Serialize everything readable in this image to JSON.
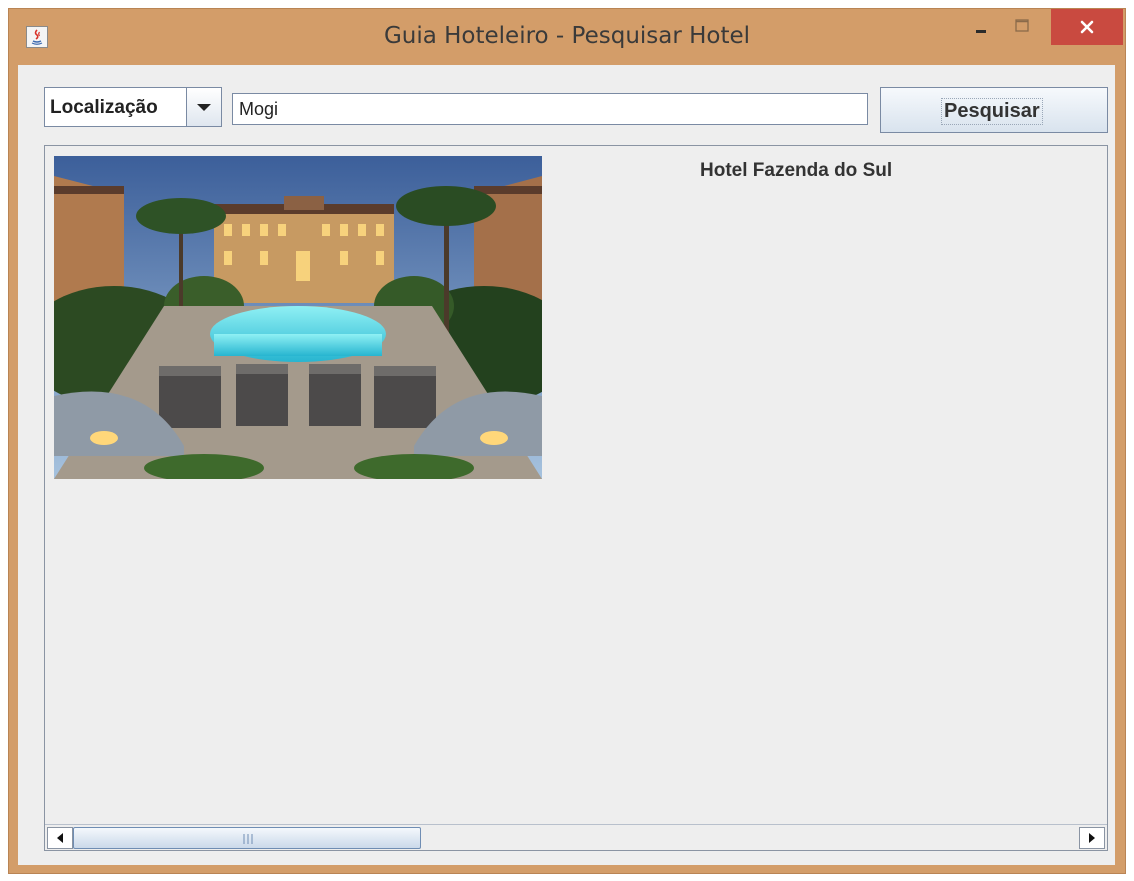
{
  "window": {
    "title": "Guia Hoteleiro - Pesquisar Hotel",
    "icon": "java-icon",
    "controls": [
      "minimize-icon",
      "maximize-icon",
      "close-icon"
    ],
    "frame_color": "#d39d69",
    "close_color": "#c94a40"
  },
  "toolbar": {
    "filter_combo": {
      "selected": "Localização",
      "icon": "chevron-down-icon"
    },
    "search_value": "Mogi",
    "search_button_label": "Pesquisar"
  },
  "results": [
    {
      "name": "Hotel Fazenda do Sul",
      "image": "hotel-photo-pool-courtyard"
    }
  ],
  "scrollbar": {
    "orientation": "horizontal",
    "left_icon": "arrow-left-icon",
    "right_icon": "arrow-right-icon",
    "thumb_fraction": 0.33
  }
}
